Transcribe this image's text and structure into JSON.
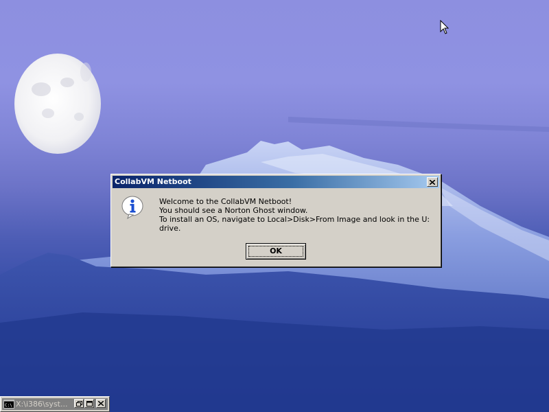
{
  "dialog": {
    "title": "CollabVM Netboot",
    "icon": "info-icon",
    "lines": [
      "Welcome to the CollabVM Netboot!",
      "You should see a Norton Ghost window.",
      "To install an OS, navigate to Local>Disk>From Image and look in the U:",
      "drive."
    ],
    "ok_label": "OK",
    "close_icon": "close-icon"
  },
  "console_window": {
    "title": "X:\\i386\\syst...",
    "icon": "command-prompt-icon",
    "buttons": [
      "restore-icon",
      "maximize-icon",
      "close-icon"
    ]
  },
  "colors": {
    "sky": "#8d8fe0",
    "mountain": "#2f48a3",
    "dialog_face": "#d4d0c8",
    "titlebar_start": "#0a246a",
    "titlebar_end": "#a6caf0"
  }
}
